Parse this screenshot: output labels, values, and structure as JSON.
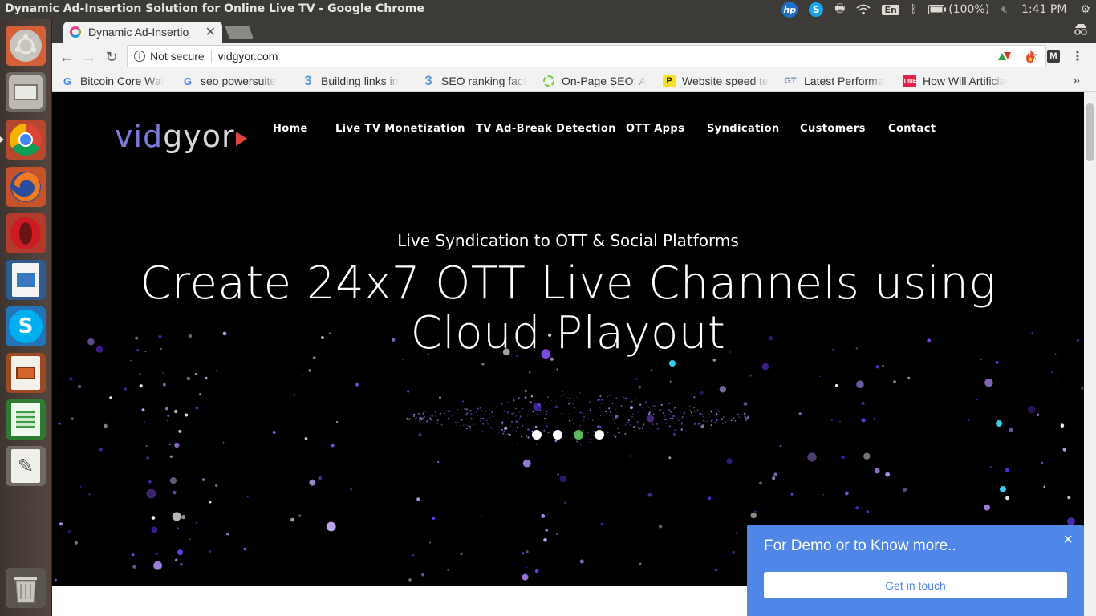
{
  "os_bar": {
    "window_title": "Dynamic Ad-Insertion Solution for Online Live TV - Google Chrome",
    "battery": "(100%)",
    "time": "1:41 PM",
    "keyboard_layout": "En",
    "hp_label": "hp",
    "skype_label": "S"
  },
  "launcher": {
    "items": [
      "ubuntu-dash",
      "files",
      "chrome",
      "firefox",
      "opera",
      "libreoffice-impress-doc",
      "skype",
      "libreoffice-impress",
      "libreoffice-calc",
      "text-editor",
      "trash"
    ]
  },
  "browser": {
    "tab_title": "Dynamic Ad-Insertio",
    "security": "Not secure",
    "url": "vidgyor.com",
    "bookmarks": [
      {
        "label": "Bitcoin Core Wal",
        "icon": "G"
      },
      {
        "label": "seo powersuite",
        "icon": "G"
      },
      {
        "label": "Building links in",
        "icon": "3"
      },
      {
        "label": "SEO ranking fact",
        "icon": "3"
      },
      {
        "label": "On-Page SEO: A",
        "icon": "O"
      },
      {
        "label": "Website speed te",
        "icon": "P"
      },
      {
        "label": "Latest Performa",
        "icon": "GT"
      },
      {
        "label": "How Will Artificia",
        "icon": "T"
      }
    ],
    "more": "»"
  },
  "site": {
    "logo_vid": "vid",
    "logo_gyor": "gyor",
    "nav": [
      "Home",
      "Live TV Monetization",
      "TV Ad-Break Detection",
      "OTT Apps",
      "Syndication",
      "Customers",
      "Contact"
    ],
    "kicker": "Live Syndication to OTT & Social Platforms",
    "headline": "Create 24x7 OTT Live Channels using Cloud Playout",
    "slides": 4,
    "active_slide": 3
  },
  "demo_popup": {
    "message": "For Demo or to Know more..",
    "close": "×",
    "button": "Get in touch"
  },
  "colors": {
    "accent": "#4f86e8",
    "active_dot": "#5cb85c",
    "logo_vid": "#7a7ad8"
  }
}
